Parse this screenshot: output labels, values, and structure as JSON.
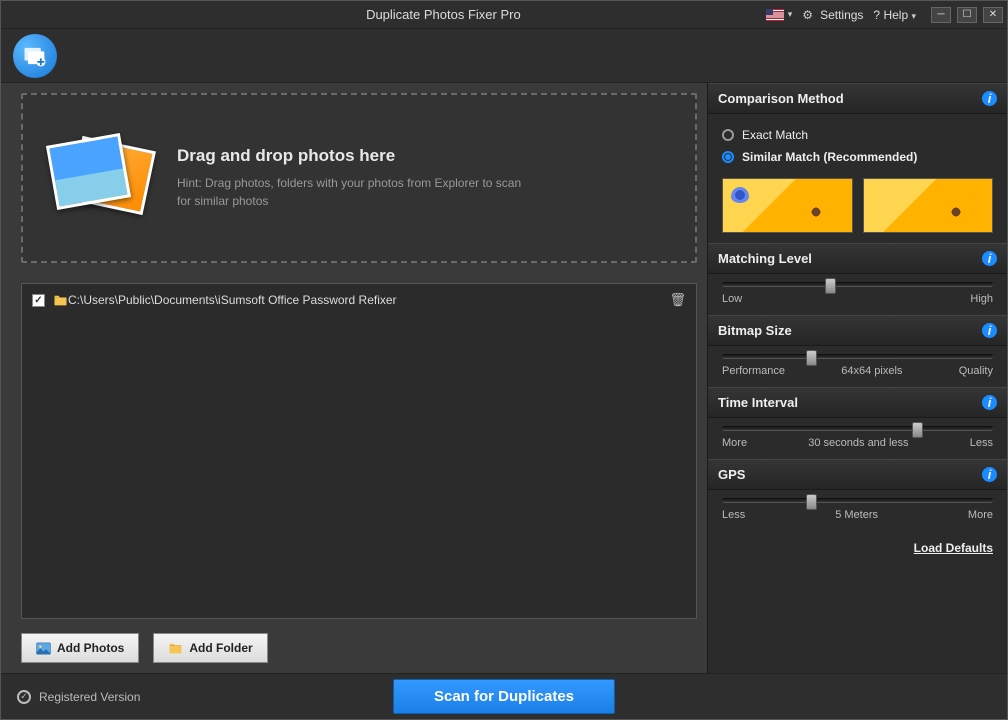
{
  "titlebar": {
    "title": "Duplicate Photos Fixer Pro",
    "settings": "Settings",
    "help": "Help"
  },
  "dropzone": {
    "heading": "Drag and drop photos here",
    "hint": "Hint: Drag photos, folders with your photos from Explorer to scan for similar photos"
  },
  "folders": [
    {
      "path": "C:\\Users\\Public\\Documents\\iSumsoft Office Password Refixer",
      "checked": true
    }
  ],
  "buttons": {
    "add_photos": "Add Photos",
    "add_folder": "Add Folder",
    "scan": "Scan for Duplicates"
  },
  "sidebar": {
    "comparison": {
      "title": "Comparison Method",
      "exact": "Exact Match",
      "similar": "Similar Match (Recommended)"
    },
    "matching_level": {
      "title": "Matching Level",
      "low": "Low",
      "high": "High",
      "value_pct": 40
    },
    "bitmap_size": {
      "title": "Bitmap Size",
      "left": "Performance",
      "right": "Quality",
      "value_label": "64x64 pixels",
      "value_pct": 33
    },
    "time_interval": {
      "title": "Time Interval",
      "left": "More",
      "right": "Less",
      "value_label": "30 seconds and less",
      "value_pct": 72
    },
    "gps": {
      "title": "GPS",
      "left": "Less",
      "right": "More",
      "value_label": "5 Meters",
      "value_pct": 33
    },
    "load_defaults": "Load Defaults"
  },
  "footer": {
    "registered": "Registered Version"
  }
}
